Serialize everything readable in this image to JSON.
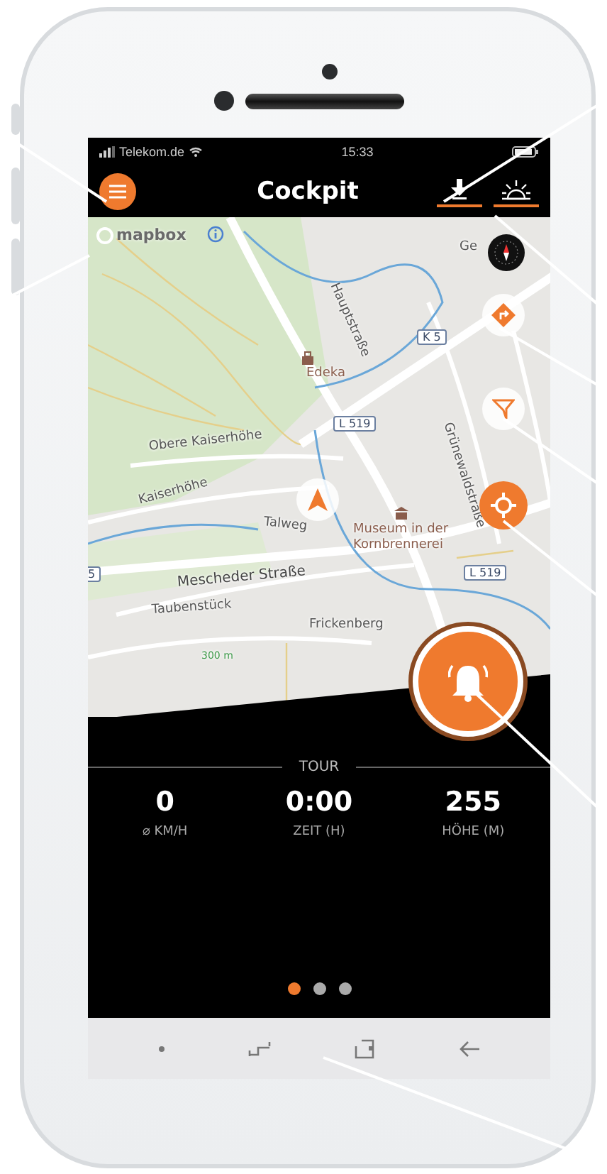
{
  "status_bar": {
    "carrier": "Telekom.de",
    "time": "15:33"
  },
  "header": {
    "title": "Cockpit",
    "toggles": [
      {
        "kind": "download",
        "on": true
      },
      {
        "kind": "daylight",
        "on": true
      }
    ]
  },
  "map": {
    "attribution": "mapbox",
    "labels": [
      {
        "text": "Ge",
        "kind": "place"
      },
      {
        "text": "Hauptstraße",
        "kind": "street"
      },
      {
        "text": "K 5",
        "kind": "road_number"
      },
      {
        "text": "Edeka",
        "kind": "poi"
      },
      {
        "text": "L 519",
        "kind": "road_number"
      },
      {
        "text": "Grünewaldstraße",
        "kind": "street"
      },
      {
        "text": "Obere Kaiserhöhe",
        "kind": "street"
      },
      {
        "text": "Kaiserhöhe",
        "kind": "street"
      },
      {
        "text": "Talweg",
        "kind": "street"
      },
      {
        "text": "Museum in der Kornbrennerei",
        "kind": "poi"
      },
      {
        "text": "L 519",
        "kind": "road_number"
      },
      {
        "text": "Mescheder Straße",
        "kind": "major_street"
      },
      {
        "text": "Taubenstück",
        "kind": "street"
      },
      {
        "text": "Frickenberg",
        "kind": "place"
      },
      {
        "text": "300 m",
        "kind": "contour"
      },
      {
        "text": "5",
        "kind": "road_number"
      }
    ]
  },
  "tour": {
    "title": "TOUR",
    "stats": [
      {
        "value": "0",
        "label": "⌀ KM/H"
      },
      {
        "value": "0:00",
        "label": "ZEIT (H)"
      },
      {
        "value": "255",
        "label": "HÖHE (M)"
      }
    ]
  },
  "pages": [
    {
      "selected": true
    },
    {
      "selected": false
    },
    {
      "selected": false
    }
  ]
}
